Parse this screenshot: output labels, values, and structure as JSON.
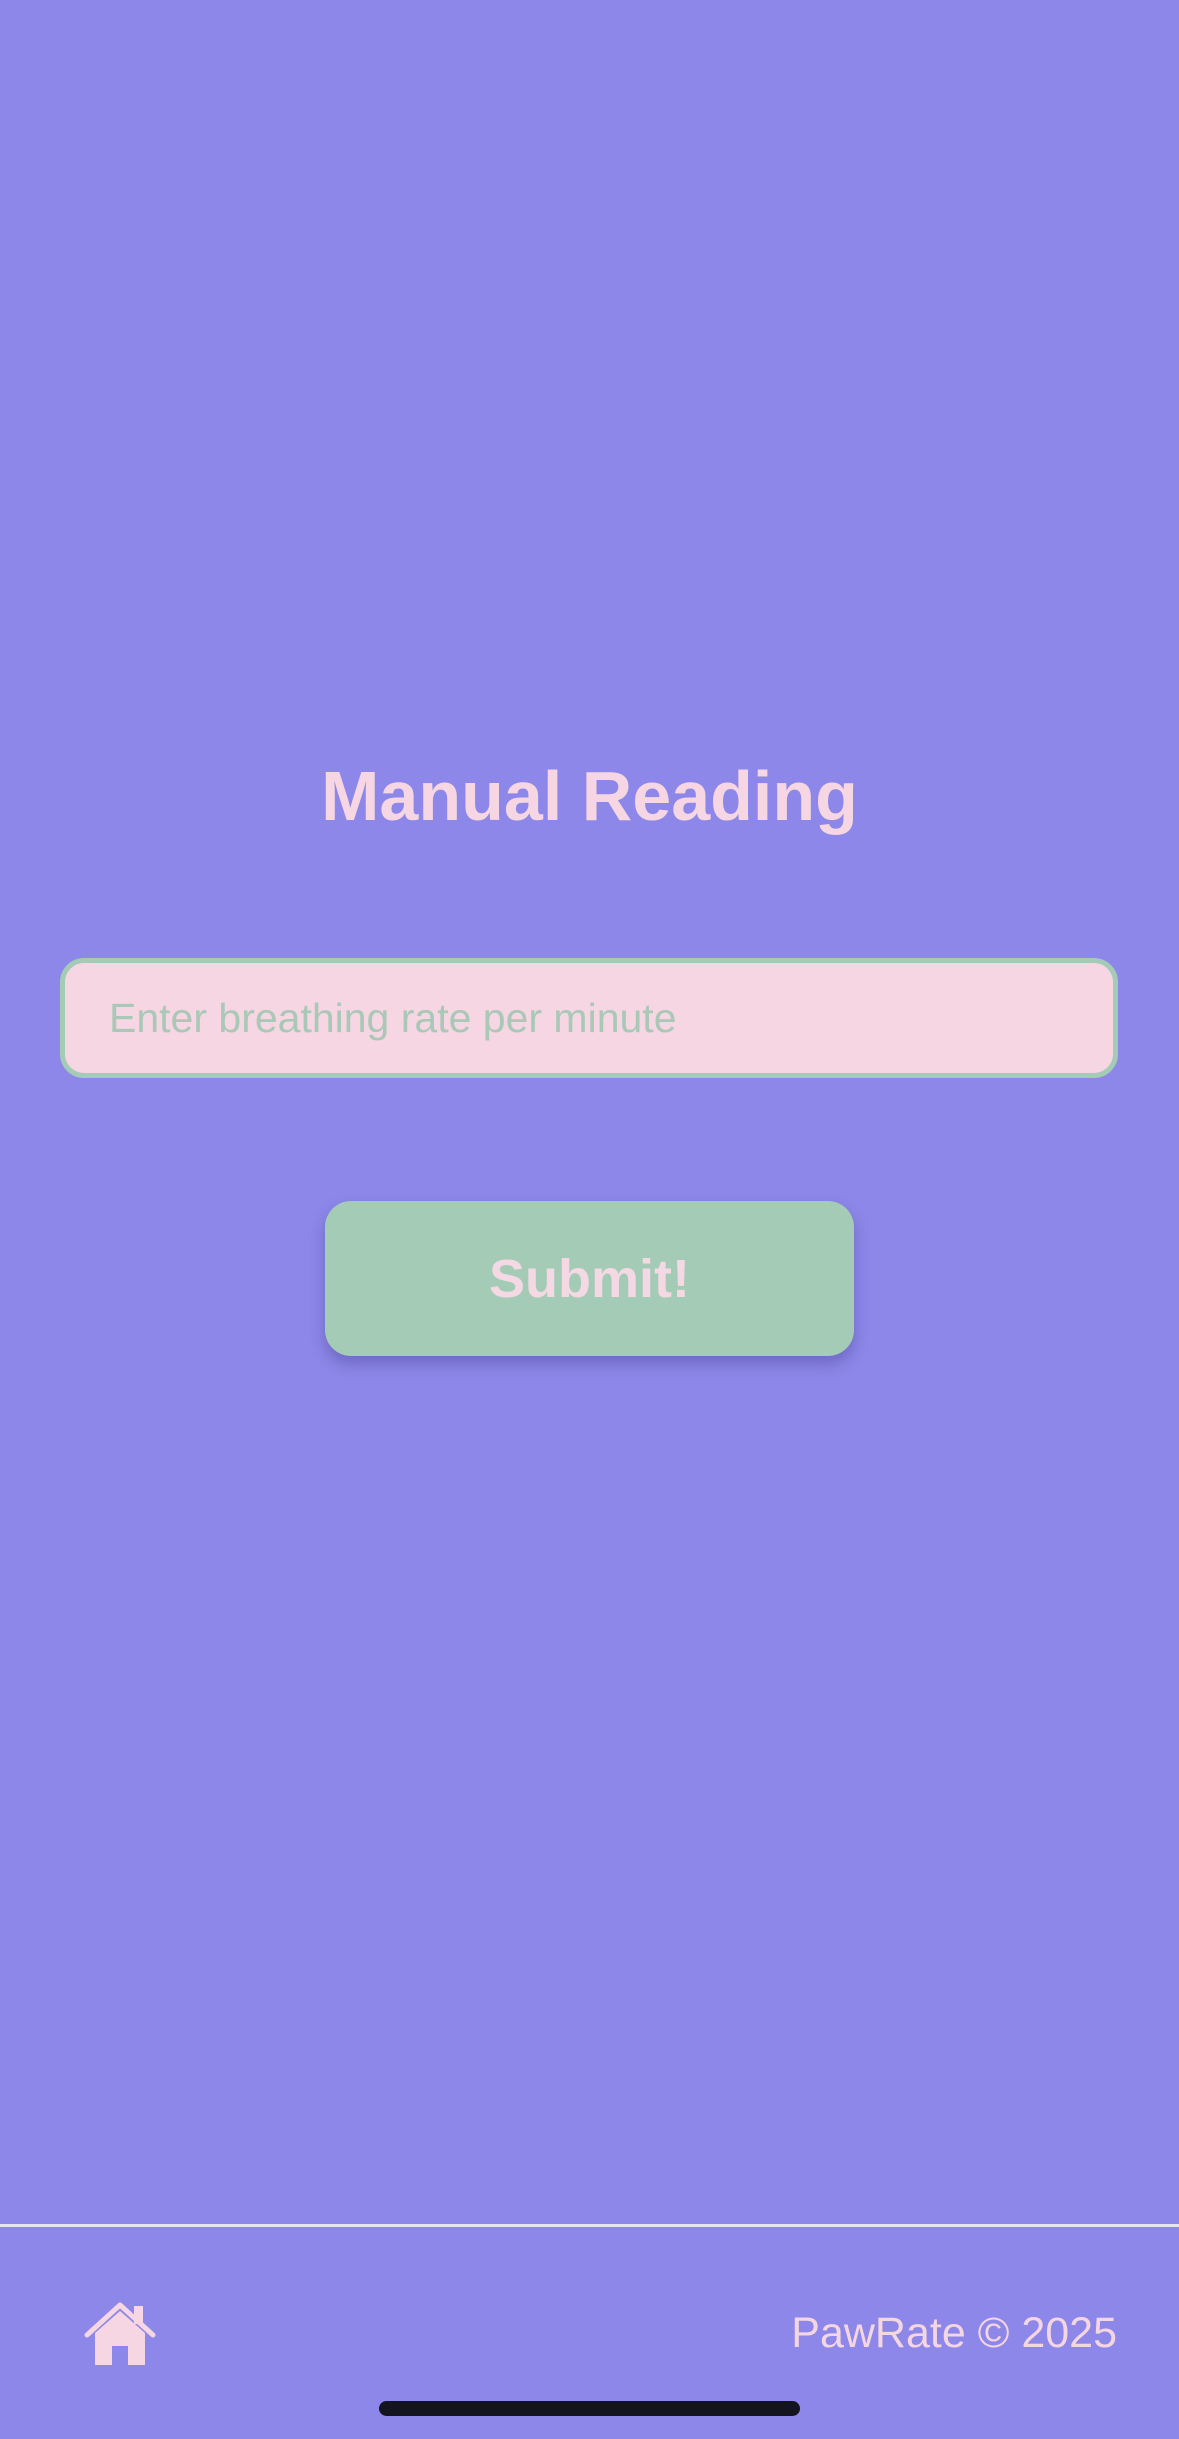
{
  "screen": {
    "title": "Manual Reading"
  },
  "form": {
    "input_placeholder": "Enter breathing rate per minute",
    "input_value": "",
    "submit_label": "Submit!"
  },
  "footer": {
    "home_icon": "home-icon",
    "copyright": "PawRate © 2025"
  },
  "colors": {
    "background": "#8c87e8",
    "accent_pink": "#f6d6e2",
    "accent_green": "#a4cbb5"
  }
}
